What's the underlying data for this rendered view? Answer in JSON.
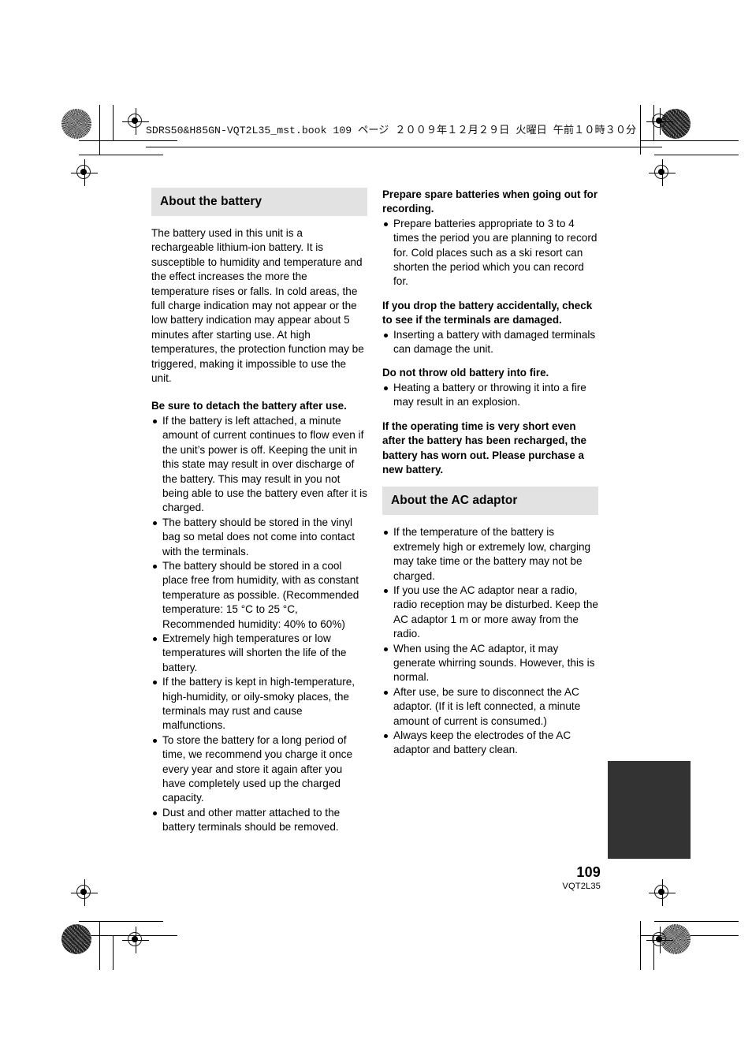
{
  "header": {
    "running_head": "SDRS50&H85GN-VQT2L35_mst.book   109 ページ   ２００９年１２月２９日   火曜日   午前１０時３０分"
  },
  "footer": {
    "page_number": "109",
    "document_code": "VQT2L35"
  },
  "colors": {
    "section_bar": "#e2e2e2",
    "thumb_index": "#333333",
    "text": "#000000"
  },
  "left_column": {
    "section_title": "About the battery",
    "intro": "The battery used in this unit is a rechargeable lithium-ion battery. It is susceptible to humidity and temperature and the effect increases the more the temperature rises or falls. In cold areas, the full charge indication may not appear or the low battery indication may appear about 5 minutes after starting use. At high temperatures, the protection function may be triggered, making it impossible to use the unit.",
    "subhead_detach": "Be sure to detach the battery after use.",
    "detach_bullets": [
      "If the battery is left attached, a minute amount of current continues to flow even if the unit’s power is off. Keeping the unit in this state may result in over discharge of the battery. This may result in you not being able to use the battery even after it is charged.",
      "The battery should be stored in the vinyl bag so metal does not come into contact with the terminals.",
      "The battery should be stored in a cool place free from humidity, with as constant temperature as possible. (Recommended temperature: 15 °C to 25 °C, Recommended humidity: 40% to 60%)",
      "Extremely high temperatures or low temperatures will shorten the life of the battery.",
      "If the battery is kept in high-temperature, high-humidity, or oily-smoky places, the terminals may rust and cause malfunctions.",
      "To store the battery for a long period of time, we recommend you charge it once every year and store it again after you have completely used up the charged capacity.",
      "Dust and other matter attached to the battery terminals should be removed."
    ]
  },
  "right_column": {
    "subhead_spare": "Prepare spare batteries when going out for recording.",
    "spare_bullets": [
      "Prepare batteries appropriate to 3 to 4 times the period you are planning to record for. Cold places such as a ski resort can shorten the period which you can record for."
    ],
    "subhead_drop": "If you drop the battery accidentally, check to see if the terminals are damaged.",
    "drop_bullets": [
      "Inserting a battery with damaged terminals can damage the unit."
    ],
    "subhead_fire": "Do not throw old battery into fire.",
    "fire_bullets": [
      "Heating a battery or throwing it into a fire may result in an explosion."
    ],
    "subhead_worn": "If the operating time is very short even after the battery has been recharged, the battery has worn out. Please purchase a new battery.",
    "section_title_ac": "About the AC adaptor",
    "ac_bullets": [
      "If the temperature of the battery is extremely high or extremely low, charging may take time or the battery may not be charged.",
      "If you use the AC adaptor near a radio, radio reception may be disturbed. Keep the AC adaptor 1 m or more away from the radio.",
      "When using the AC adaptor, it may generate whirring sounds. However, this is normal.",
      "After use, be sure to disconnect the AC adaptor. (If it is left connected, a minute amount of current is consumed.)",
      "Always keep the electrodes of the AC adaptor and battery clean."
    ]
  }
}
